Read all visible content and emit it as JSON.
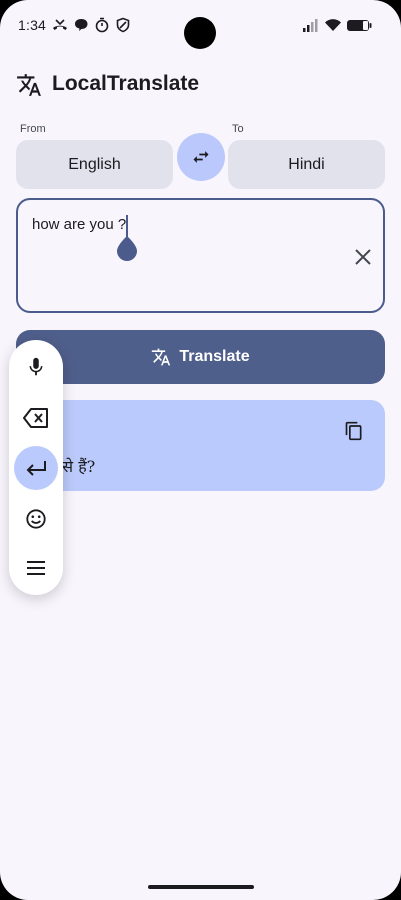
{
  "status_bar": {
    "time": "1:34",
    "left_icons": [
      "missed-call-icon",
      "chat-bubble-icon",
      "timer-icon",
      "shield-icon"
    ],
    "right_icons": [
      "signal-icon",
      "wifi-icon",
      "battery-icon"
    ]
  },
  "app_bar": {
    "title": "LocalTranslate",
    "icon": "translate-icon"
  },
  "language": {
    "from_label": "From",
    "from_value": "English",
    "to_label": "To",
    "to_value": "Hindi",
    "swap_icon": "swap-icon"
  },
  "input": {
    "text": "how are you ?",
    "clear_icon": "close-icon"
  },
  "translate_button": {
    "label": "Translate",
    "icon": "translate-icon"
  },
  "result": {
    "text": "कैसे हैं?",
    "copy_icon": "copy-icon"
  },
  "floating_toolbar": {
    "items": [
      "microphone-icon",
      "backspace-icon",
      "enter-icon",
      "emoji-icon",
      "menu-icon"
    ],
    "active": "enter-icon"
  },
  "colors": {
    "background": "#f9f5fd",
    "primary": "#4f5f8b",
    "secondary_container": "#bbcafc",
    "surface_variant": "#e1e2ec"
  }
}
